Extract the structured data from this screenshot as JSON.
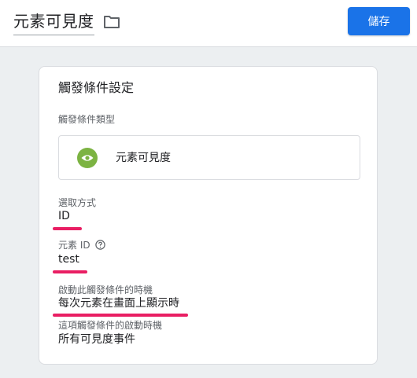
{
  "header": {
    "title": "元素可見度",
    "save_label": "儲存"
  },
  "card": {
    "title": "觸發條件設定",
    "trigger_type_label": "觸發條件類型",
    "trigger_type_value": "元素可見度",
    "selection_method_label": "選取方式",
    "selection_method_value": "ID",
    "element_id_label": "元素 ID",
    "element_id_value": "test",
    "fire_timing_label": "啟動此觸發條件的時機",
    "fire_timing_value": "每次元素在畫面上顯示時",
    "fire_scope_label": "這項觸發條件的啟動時機",
    "fire_scope_value": "所有可見度事件"
  },
  "colors": {
    "accent": "#1a73e8",
    "eye_icon": "#7cb342",
    "highlight_underline": "#e91e63"
  },
  "icons": [
    "folder-icon",
    "eye-icon",
    "help-icon"
  ]
}
